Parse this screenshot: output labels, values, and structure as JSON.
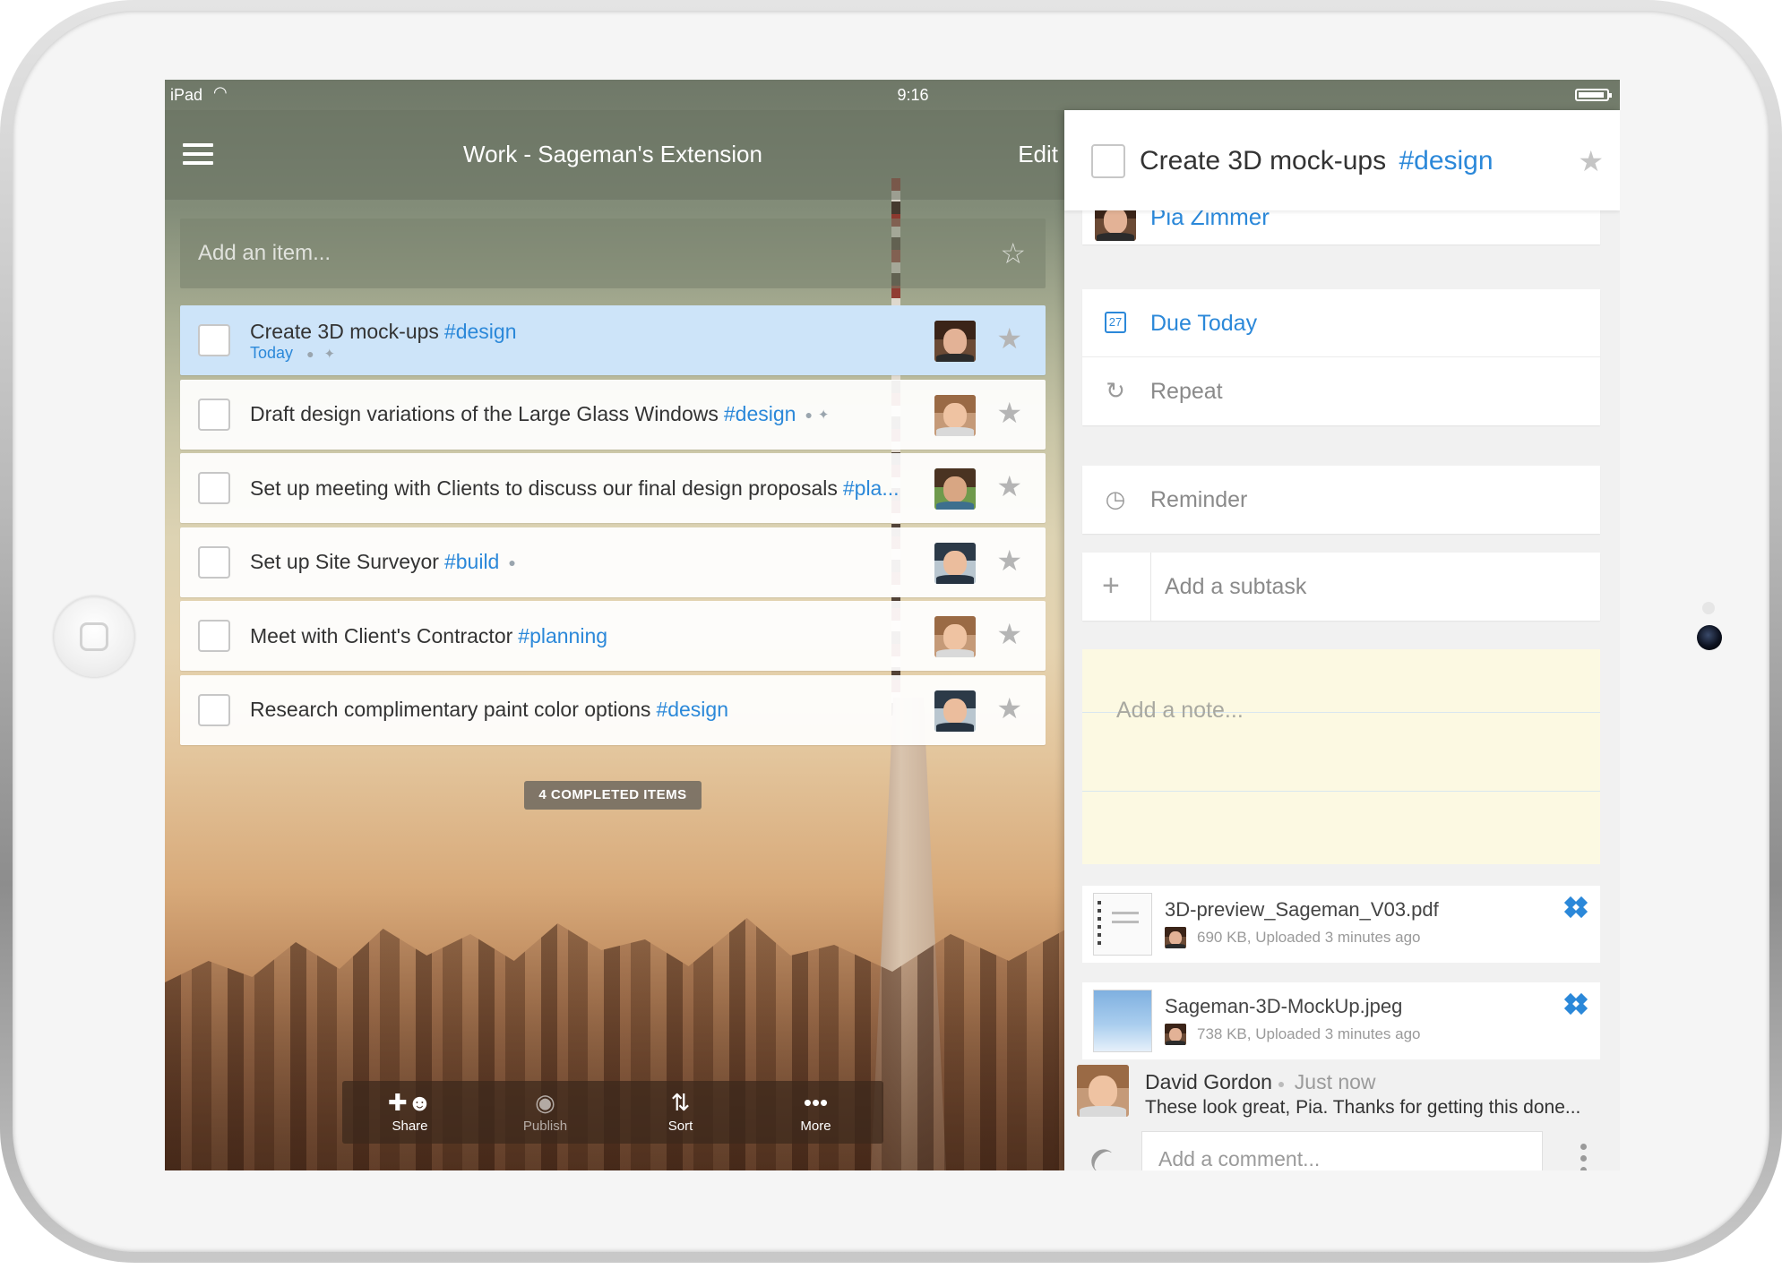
{
  "status_bar": {
    "device": "iPad",
    "time": "9:16"
  },
  "nav": {
    "title": "Work - Sageman's Extension",
    "edit_label": "Edit"
  },
  "add_item": {
    "placeholder": "Add an item..."
  },
  "tasks": [
    {
      "title": "Create 3D mock-ups",
      "tag": "#design",
      "sub": "Today",
      "selected": true
    },
    {
      "title": "Draft design variations of the Large Glass Windows",
      "tag": "#design"
    },
    {
      "title": "Set up meeting with Clients to discuss our final design proposals",
      "tag": "#pla..."
    },
    {
      "title": "Set up Site Surveyor",
      "tag": "#build"
    },
    {
      "title": "Meet with Client's Contractor",
      "tag": "#planning"
    },
    {
      "title": "Research complimentary paint color options",
      "tag": "#design"
    }
  ],
  "completed_label": "4 COMPLETED ITEMS",
  "toolbar": {
    "share": "Share",
    "publish": "Publish",
    "sort": "Sort",
    "more": "More"
  },
  "detail": {
    "title": "Create 3D mock-ups",
    "tag": "#design",
    "assignee": "Pia Zimmer",
    "due": "Due Today",
    "due_day": "27",
    "repeat": "Repeat",
    "reminder": "Reminder",
    "subtask_placeholder": "Add a subtask",
    "note_placeholder": "Add a note...",
    "files": [
      {
        "name": "3D-preview_Sageman_V03.pdf",
        "meta": "690 KB, Uploaded 3 minutes ago"
      },
      {
        "name": "Sageman-3D-MockUp.jpeg",
        "meta": "738 KB, Uploaded 3 minutes ago"
      }
    ],
    "comment": {
      "author": "David Gordon",
      "time": "Just now",
      "text": "These look great, Pia. Thanks for getting this done..."
    },
    "comment_placeholder": "Add a comment..."
  },
  "colors": {
    "accent": "#2b88d9",
    "selected_row": "#cde4f9",
    "note_bg": "#fcf9e2"
  }
}
